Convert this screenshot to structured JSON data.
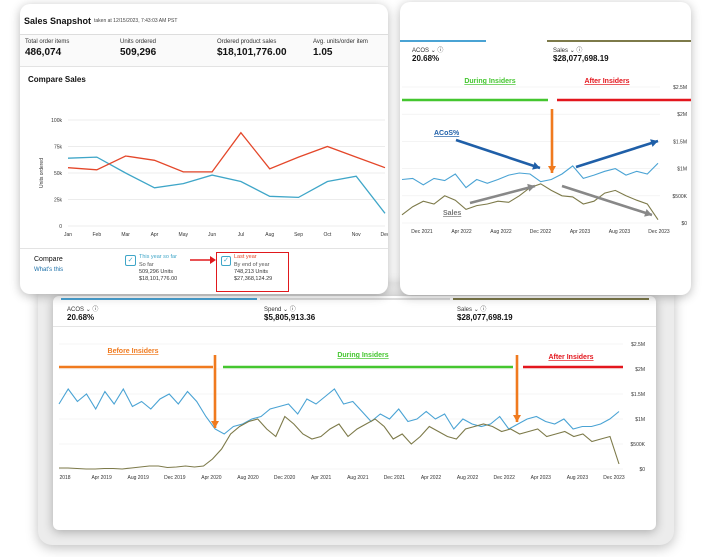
{
  "snapshot": {
    "title": "Sales Snapshot",
    "taken_at": "taken at 12/15/2023, 7:43:03 AM PST",
    "metrics": [
      {
        "label": "Total order items",
        "value": "486,074"
      },
      {
        "label": "Units ordered",
        "value": "509,296"
      },
      {
        "label": "Ordered product sales",
        "value": "$18,101,776.00"
      },
      {
        "label": "Avg. units/order item",
        "value": "1.05"
      }
    ],
    "compare_title": "Compare Sales",
    "compare_label": "Compare",
    "whats_this": "What's this",
    "this_year": {
      "title": "This year so far",
      "line1": "So far",
      "units": "509,296 Units",
      "sales": "$18,101,776.00"
    },
    "last_year": {
      "title": "Last year",
      "line1": "By end of year",
      "units": "748,213 Units",
      "sales": "$27,368,124.29"
    },
    "colors": {
      "this_year": "#3fa6c8",
      "last_year": "#e4472a",
      "highlight_box": "#e0191d"
    }
  },
  "top_right": {
    "acos_label": "ACOS",
    "acos_value": "20.68%",
    "sales_label": "Sales",
    "sales_value": "$28,077,698.19",
    "phase_during": "During Insiders",
    "phase_after": "After Insiders",
    "acos_annotation": "ACoS%",
    "sales_annotation": "Sales",
    "colors": {
      "acos": "#4aa3d4",
      "sales": "#7d7a4a",
      "during": "#44c62f",
      "after": "#e3161d",
      "arrow_blue": "#1f5fa8",
      "arrow_grey": "#888888",
      "arrow_orange": "#f07a1e"
    }
  },
  "bottom": {
    "acos_label": "ACOS",
    "acos_value": "20.68%",
    "spend_label": "Spend",
    "spend_value": "$5,805,913.36",
    "sales_label": "Sales",
    "sales_value": "$28,077,698.19",
    "phase_before": "Before Insiders",
    "phase_during": "During Insiders",
    "phase_after": "After Insiders",
    "colors": {
      "before": "#f07a1e",
      "during": "#44c62f",
      "after": "#e3161d"
    }
  },
  "chart_data": [
    {
      "type": "line",
      "title": "Compare Sales",
      "ylabel": "Units ordered",
      "categories": [
        "Jan",
        "Feb",
        "Mar",
        "Apr",
        "May",
        "Jun",
        "Jul",
        "Aug",
        "Sep",
        "Oct",
        "Nov",
        "Dec"
      ],
      "yticks": [
        "0",
        "25k",
        "50k",
        "75k",
        "100k"
      ],
      "ylim": [
        0,
        100000
      ],
      "series": [
        {
          "name": "This year so far",
          "values": [
            64000,
            65000,
            50000,
            36000,
            40000,
            48000,
            42000,
            28000,
            27000,
            42000,
            47000,
            12000
          ]
        },
        {
          "name": "Last year",
          "values": [
            55000,
            53000,
            66000,
            62000,
            51000,
            51000,
            88000,
            54000,
            65000,
            75000,
            65000,
            55000
          ]
        }
      ]
    },
    {
      "type": "line",
      "xticks": [
        "Dec 2021",
        "Apr 2022",
        "Aug 2022",
        "Dec 2022",
        "Apr 2023",
        "Aug 2023",
        "Dec 2023"
      ],
      "yticks_right": [
        "$0",
        "$500K",
        "$1M",
        "$1.5M",
        "$2M",
        "$2.5M"
      ],
      "ylim": [
        0,
        2500000
      ],
      "series": [
        {
          "name": "ACOS",
          "values": [
            800000,
            820000,
            700000,
            820000,
            780000,
            900000,
            650000,
            800000,
            730000,
            800000,
            880000,
            920000,
            900000,
            760000,
            800000,
            900000,
            1050000,
            820000,
            880000,
            950000,
            1000000,
            880000,
            950000,
            900000,
            1100000
          ]
        },
        {
          "name": "Sales",
          "values": [
            150000,
            300000,
            400000,
            350000,
            500000,
            420000,
            250000,
            320000,
            350000,
            400000,
            380000,
            500000,
            650000,
            720000,
            600000,
            500000,
            480000,
            350000,
            400000,
            550000,
            600000,
            500000,
            420000,
            350000,
            60000
          ]
        }
      ]
    },
    {
      "type": "line",
      "xticks": [
        "2018",
        "Apr 2019",
        "Aug 2019",
        "Dec 2019",
        "Apr 2020",
        "Aug 2020",
        "Dec 2020",
        "Apr 2021",
        "Aug 2021",
        "Dec 2021",
        "Apr 2022",
        "Aug 2022",
        "Dec 2022",
        "Apr 2023",
        "Aug 2023",
        "Dec 2023"
      ],
      "yticks_right": [
        "$0",
        "$500K",
        "$1M",
        "$1.5M",
        "$2M",
        "$2.5M"
      ],
      "ylim": [
        0,
        2500000
      ],
      "series": [
        {
          "name": "ACOS",
          "values": [
            1300000,
            1600000,
            1350000,
            1500000,
            1200000,
            1550000,
            1300000,
            1600000,
            1250000,
            1350000,
            1200000,
            1400000,
            1500000,
            1300000,
            1550000,
            1350000,
            1050000,
            800000,
            700000,
            850000,
            900000,
            1000000,
            1050000,
            1200000,
            1250000,
            1300000,
            1100000,
            1400000,
            1300000,
            1450000,
            1600000,
            1300000,
            1350000,
            1150000,
            950000,
            1100000,
            1000000,
            1200000,
            950000,
            1000000,
            1150000,
            1000000,
            1100000,
            800000,
            1000000,
            900000,
            850000,
            900000,
            1050000,
            800000,
            900000,
            1000000,
            1050000,
            950000,
            900000,
            1000000,
            800000,
            850000,
            850000,
            900000,
            1000000,
            1150000
          ]
        },
        {
          "name": "Sales",
          "values": [
            20000,
            20000,
            10000,
            0,
            0,
            10000,
            10000,
            0,
            20000,
            40000,
            60000,
            60000,
            30000,
            40000,
            60000,
            40000,
            60000,
            200000,
            400000,
            700000,
            850000,
            950000,
            1000000,
            800000,
            650000,
            1050000,
            900000,
            700000,
            600000,
            650000,
            800000,
            900000,
            650000,
            800000,
            900000,
            1000000,
            850000,
            600000,
            700000,
            500000,
            650000,
            850000,
            750000,
            650000,
            600000,
            800000,
            850000,
            900000,
            850000,
            750000,
            800000,
            700000,
            750000,
            800000,
            650000,
            700000,
            750000,
            650000,
            700000,
            550000,
            600000,
            650000,
            100000
          ]
        }
      ]
    }
  ]
}
